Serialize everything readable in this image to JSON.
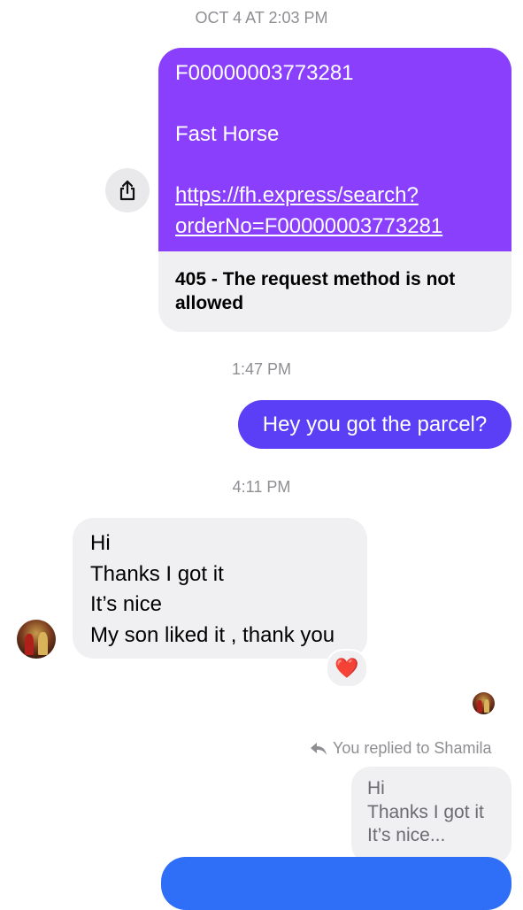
{
  "timestamps": {
    "first": "OCT 4 AT 2:03 PM",
    "second": "1:47 PM",
    "third": "4:11 PM"
  },
  "link_message": {
    "line1": "F00000003773281",
    "line2": "Fast Horse",
    "url_line1": "https://fh.express/search?",
    "url_line2": "orderNo=F00000003773281",
    "preview_title": "405 - The request method is not allowed"
  },
  "outgoing_message": "Hey you got the parcel?",
  "incoming_message": {
    "line1": "Hi",
    "line2": "Thanks I got it",
    "line3": "It’s nice",
    "line4": "My son liked it , thank you"
  },
  "reaction": "❤️",
  "reply_note": "You replied to Shamila",
  "quoted_message": {
    "line1": "Hi",
    "line2": "Thanks I got it",
    "line3": "It’s nice..."
  },
  "colors": {
    "link_bubble": "#8a3ffc",
    "outgoing_bubble": "#5b3ff6",
    "cut_bubble": "#2f6ef6",
    "incoming_bubble": "#f0f0f2",
    "timestamp": "#8e8e93"
  },
  "icons": [
    "share-icon",
    "reply-arrow-icon",
    "heart-reaction-icon"
  ]
}
